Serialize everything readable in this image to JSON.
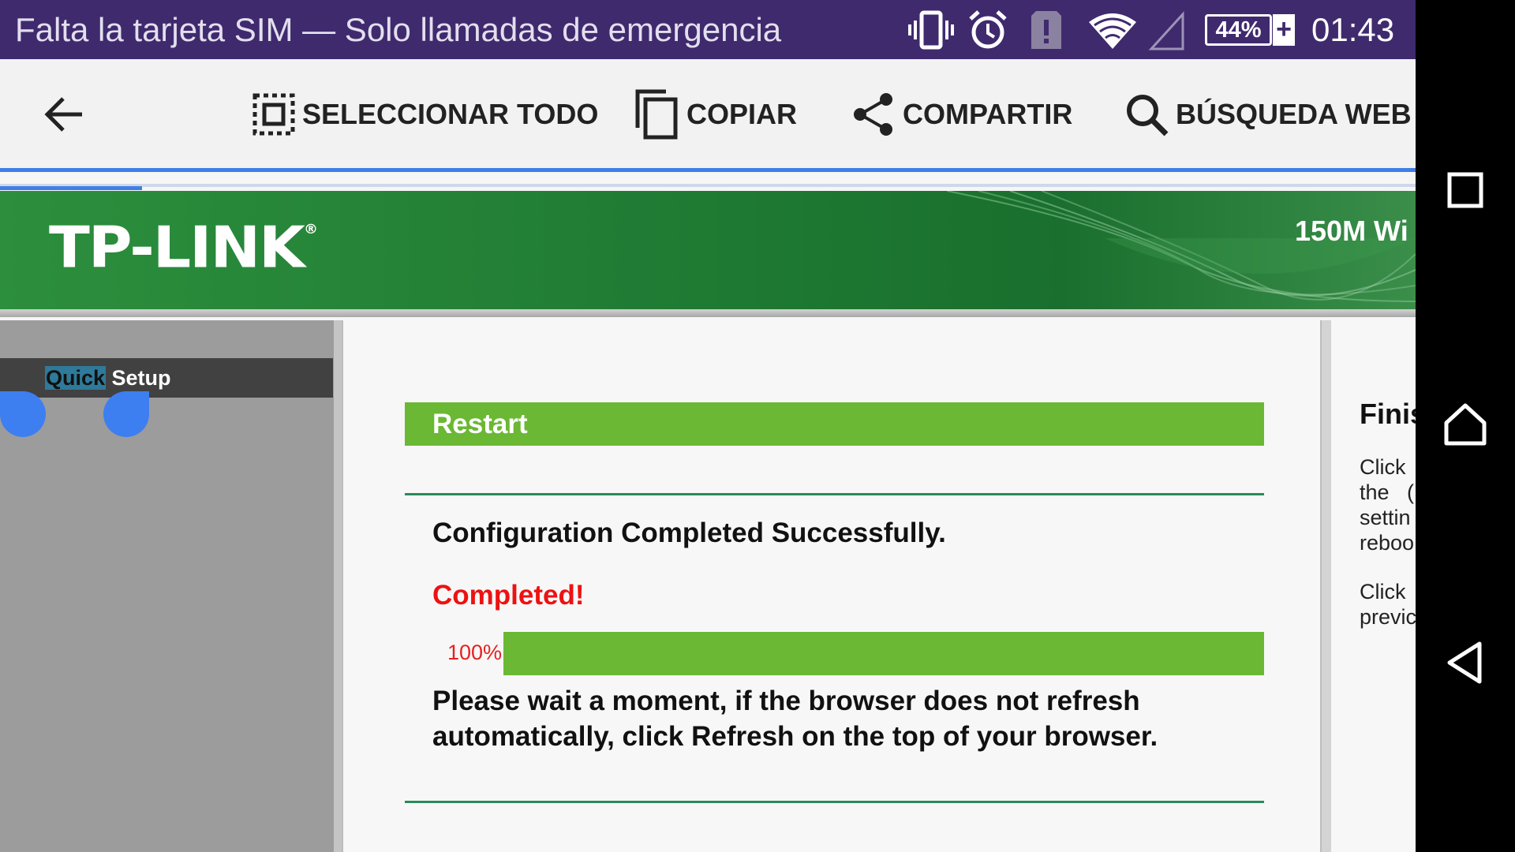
{
  "status_bar": {
    "notification": "Falta la tarjeta SIM — Solo llamadas de emergencia",
    "battery": "44%",
    "battery_plus": "+",
    "time": "01:43",
    "icons": [
      "vibrate-icon",
      "alarm-icon",
      "alert-icon",
      "wifi-icon",
      "no-signal-icon",
      "battery-charging-icon"
    ]
  },
  "action_bar": {
    "select_all": "SELECCIONAR TODO",
    "copy": "COPIAR",
    "share": "COMPARTIR",
    "web_search": "BÚSQUEDA WEB"
  },
  "header": {
    "logo": "TP-LINK",
    "logo_mark": "®",
    "title": "150M Wi"
  },
  "sidebar": {
    "item_selected_word": "Quick",
    "item_rest": " Setup"
  },
  "main": {
    "section_title": "Restart",
    "config_message": "Configuration Completed Successfully.",
    "completed": "Completed!",
    "progress_label": "100%",
    "progress_value": 1.0,
    "wait_message": "Please wait a moment, if the browser does not refresh automatically, click Refresh on the top of your browser."
  },
  "help": {
    "title": "Finis",
    "para1": "Click\nthe   (\nsettin\nreboo",
    "para2": "Click\nprevic"
  },
  "colors": {
    "status_bar": "#3f2a6e",
    "accent_blue": "#3f7fe6",
    "tplink_green": "#238036",
    "light_green": "#6ab833",
    "completed_red": "#ee1111"
  }
}
